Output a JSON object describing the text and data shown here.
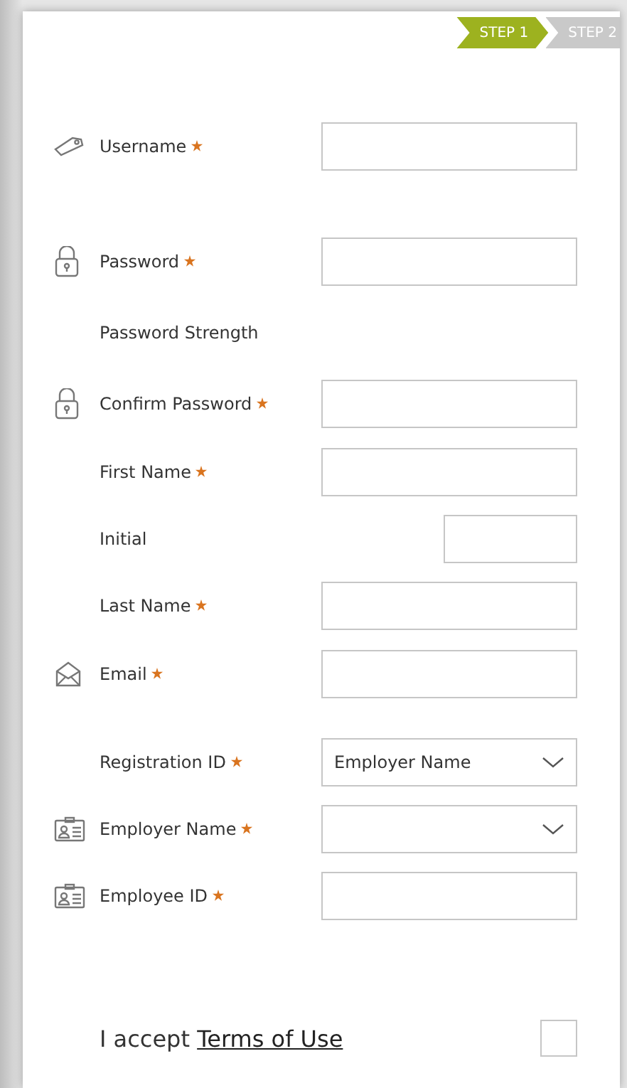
{
  "steps": [
    {
      "label": "STEP 1",
      "selected": true
    },
    {
      "label": "STEP 2",
      "selected": false
    }
  ],
  "fields": [
    {
      "kind": "text",
      "label": "Username",
      "required": true
    },
    {
      "kind": "text",
      "label": "Password",
      "required": true
    },
    {
      "kind": "note",
      "label": "Password Strength",
      "required": false
    },
    {
      "kind": "text",
      "label": "Confirm Password",
      "required": true
    },
    {
      "kind": "text",
      "label": "First Name",
      "required": true
    },
    {
      "kind": "short",
      "label": "Initial",
      "required": false
    },
    {
      "kind": "text",
      "label": "Last Name",
      "required": true
    },
    {
      "kind": "text",
      "label": "Email",
      "required": true
    },
    {
      "kind": "select",
      "label": "Registration ID",
      "required": true,
      "value": "Employer Name"
    },
    {
      "kind": "select",
      "label": "Employer Name",
      "required": true
    },
    {
      "kind": "text",
      "label": "Employee ID",
      "required": true
    }
  ],
  "terms": {
    "text": "I accept",
    "link": "Terms of Use",
    "checked": false
  }
}
